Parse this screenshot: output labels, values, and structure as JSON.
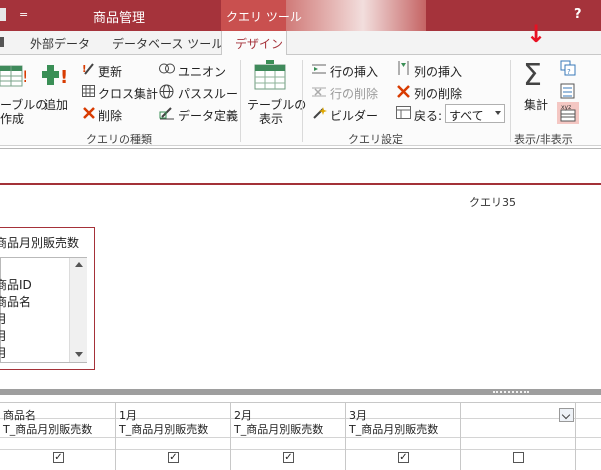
{
  "titlebar": {
    "title": "商品管理",
    "context_tab": "クエリ ツール",
    "help": "?",
    "qat_dropdown": "="
  },
  "tabs": [
    "外部データ",
    "データベース ツール",
    "デザイン"
  ],
  "ribbon": {
    "query_type_group": {
      "label": "クエリの種類",
      "make_table": [
        "ーブルの",
        "作成"
      ],
      "append": "追加",
      "update": "更新",
      "crosstab": "クロス集計",
      "delete": "削除",
      "union": "ユニオン",
      "pass_through": "パススルー",
      "data_definition": "データ定義"
    },
    "query_setup_group": {
      "label": "クエリ設定",
      "show_table": [
        "テーブルの",
        "表示"
      ],
      "insert_rows": "行の挿入",
      "delete_rows": "行の削除",
      "builder": "ビルダー",
      "insert_columns": "列の挿入",
      "delete_columns": "列の削除",
      "return_label": "戻る:",
      "return_value": "すべて"
    },
    "show_hide_group": {
      "label": "表示/非表示",
      "totals": "集計",
      "totals_symbol": "Σ",
      "annotation_arrow": "↓"
    }
  },
  "query_name": "クエリ35",
  "table_box": {
    "title": "商品月別販売数",
    "fields": [
      "商品ID",
      "商品名",
      "月",
      "月",
      "月"
    ]
  },
  "grid": {
    "columns": [
      {
        "field": "商品名",
        "table": "T_商品月別販売数",
        "show": true
      },
      {
        "field": "1月",
        "table": "T_商品月別販売数",
        "show": true
      },
      {
        "field": "2月",
        "table": "T_商品月別販売数",
        "show": true
      },
      {
        "field": "3月",
        "table": "T_商品月別販売数",
        "show": true
      },
      {
        "field": "",
        "table": "",
        "show": false
      }
    ]
  },
  "colors": {
    "title_bar": "#a5333b",
    "accent_red": "#e81123",
    "context_tab": "#c9504f"
  }
}
